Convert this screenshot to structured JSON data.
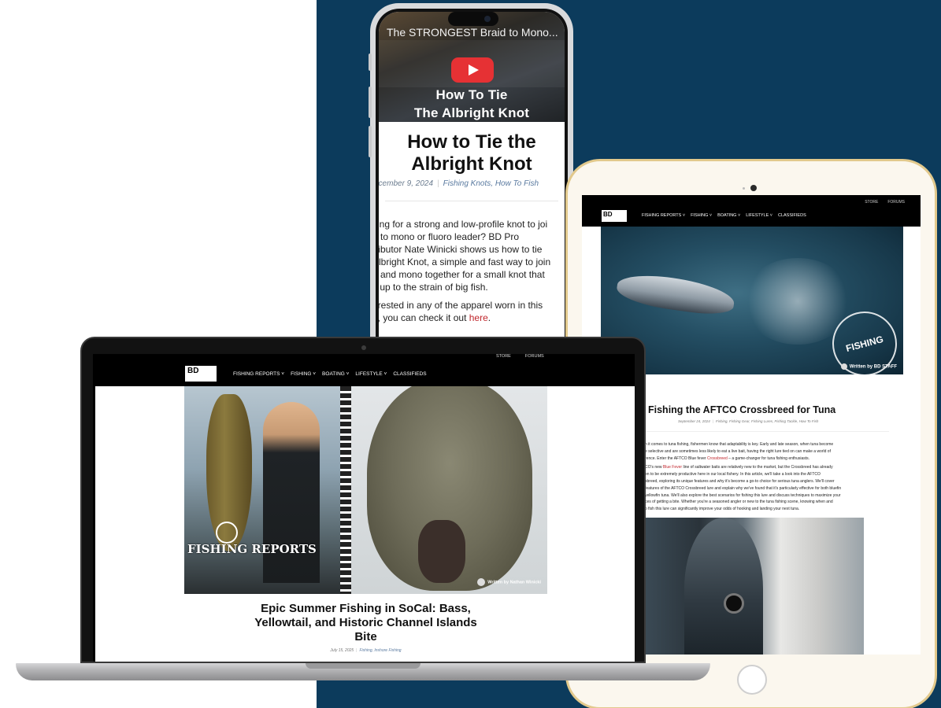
{
  "phone": {
    "video_title": "The STRONGEST Braid to Mono...",
    "video_caption_line1": "How To Tie",
    "video_caption_line2": "The Albright Knot",
    "article_title": "How to Tie the Albright Knot",
    "date": "ecember 9, 2024",
    "categories": "Fishing Knots, How To Fish",
    "body_lines": [
      "king for a strong and low-profile knot to joi",
      "d to mono or fluoro leader? BD Pro",
      "tributor Nate Winicki shows us how to tie",
      "Albright Knot, a simple and fast way to join",
      "d and mono together for a small knot that",
      "s up to the strain of big fish."
    ],
    "body2_line1": "erested in any of the apparel worn in this",
    "body2_line2_prefix": "o, you can check it out ",
    "body2_link": "here",
    "body2_suffix": "."
  },
  "tablet": {
    "top_links": [
      "STORE",
      "FORUMS"
    ],
    "logo": "BD",
    "nav": [
      "FISHING REPORTS ˅",
      "FISHING ˅",
      "BOATING ˅",
      "LIFESTYLE ˅",
      "CLASSIFIEDS"
    ],
    "badge": "FISHING GEAR",
    "author": "Written by BD STAFF",
    "title": "Fishing the AFTCO Crossbreed for Tuna",
    "date": "September 24, 2024",
    "categories": "Fishing, Fishing Gear, Fishing Lures, Fishing Tackle, How To Fish",
    "p1_lines": [
      "n it comes to tuna fishing, fishermen know that adaptability is key. Early and late season, when tuna become",
      "e selective and are sometimes less likely to eat a live bait, having the right lure tied on can make a world of"
    ],
    "p1_last_prefix": "rence. Enter the AFTCO Blue fever ",
    "p1_link": "Crossbreed",
    "p1_last_suffix": " – a game-changer for tuna fishing enthusiasts.",
    "p2_first_prefix": "CO's new ",
    "p2_link": "Blue Fever",
    "p2_first_suffix": " line of saltwater baits are relatively new to the market, but the Crossbreed has already",
    "p2_lines": [
      "en to be extremely productive here in our local fishery. In this article, we'll take a look into the AFTCO",
      "sbreed, exploring its unique features and why it's become a go-to choice for serious tuna anglers. We'll cover",
      "features of the AFTCO Crossbreed lure and explain why we've found that it's particularly effective for both bluefin",
      "yellowfin tuna. We'll also explore the best scenarios for fishing this lure and discuss techniques to maximize your",
      "ces of getting a bite. Whether you're a seasoned angler or new to the tuna fishing scene, knowing when and",
      "o fish this lure can significantly improve your odds of hooking and landing your next tuna."
    ]
  },
  "laptop": {
    "top_links": [
      "STORE",
      "FORUMS"
    ],
    "logo": "BD",
    "nav": [
      "FISHING REPORTS ˅",
      "FISHING ˅",
      "BOATING ˅",
      "LIFESTYLE ˅",
      "CLASSIFIEDS"
    ],
    "badge": "FISHING REPORTS",
    "author": "Written by Nathan Winicki",
    "title_line1": "Epic Summer Fishing in SoCal: Bass,",
    "title_line2": "Yellowtail, and Historic Channel Islands",
    "title_line3": "Bite",
    "date": "July 15, 2025",
    "categories": "Fishing, Inshore Fishing"
  },
  "colors": {
    "navy": "#0c3b5c",
    "link_red": "#c0272d",
    "youtube_red": "#e5262a",
    "tablet_gold": "#e2c98c"
  }
}
